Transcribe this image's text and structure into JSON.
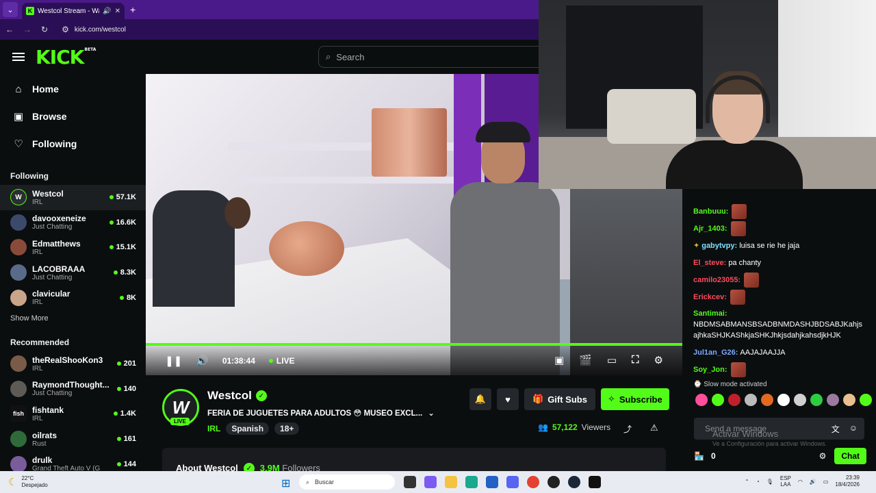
{
  "browser": {
    "tab_title": "Westcol Stream - Watch Li",
    "url": "kick.com/westcol"
  },
  "header": {
    "logo": "KICK",
    "logo_badge": "BETA",
    "search_placeholder": "Search"
  },
  "sidebar": {
    "nav": [
      {
        "label": "Home",
        "icon": "home-icon"
      },
      {
        "label": "Browse",
        "icon": "browse-icon"
      },
      {
        "label": "Following",
        "icon": "heart-icon"
      }
    ],
    "following_title": "Following",
    "following": [
      {
        "name": "Westcol",
        "category": "IRL",
        "viewers": "57.1K"
      },
      {
        "name": "davooxeneize",
        "category": "Just Chatting",
        "viewers": "16.6K"
      },
      {
        "name": "Edmatthews",
        "category": "IRL",
        "viewers": "15.1K"
      },
      {
        "name": "LACOBRAAA",
        "category": "Just Chatting",
        "viewers": "8.3K"
      },
      {
        "name": "clavicular",
        "category": "IRL",
        "viewers": "8K"
      }
    ],
    "show_more": "Show More",
    "recommended_title": "Recommended",
    "recommended": [
      {
        "name": "theRealShooKon3",
        "category": "IRL",
        "viewers": "201"
      },
      {
        "name": "RaymondThought...",
        "category": "Just Chatting",
        "viewers": "140"
      },
      {
        "name": "fishtank",
        "category": "IRL",
        "viewers": "1.4K"
      },
      {
        "name": "oilrats",
        "category": "Rust",
        "viewers": "161"
      },
      {
        "name": "drulk",
        "category": "Grand Theft Auto V (G",
        "viewers": "144"
      }
    ]
  },
  "player": {
    "time": "01:38:44",
    "live": "LIVE"
  },
  "channel": {
    "name": "Westcol",
    "avatar_letter": "W",
    "live_badge": "LIVE",
    "title": "FERIA DE JUGUETES PARA ADULTOS 😳 MUSEO EXCL...",
    "category": "IRL",
    "tags": [
      "Spanish",
      "18+"
    ],
    "gift_label": "Gift Subs",
    "subscribe_label": "Subscribe",
    "viewers": "57,122",
    "viewers_label": "Viewers",
    "about_title": "About Westcol",
    "followers": "3.9M",
    "followers_label": "Followers"
  },
  "chat": {
    "messages": [
      {
        "user": "Banbuuu:",
        "text": "",
        "color": "#53fc18",
        "emote": true
      },
      {
        "user": "Ajr_1403:",
        "text": "",
        "color": "#53fc18",
        "emote": true
      },
      {
        "user": "gabytvpy:",
        "text": "luisa se rie he jaja",
        "color": "#7ee0ff",
        "emote": false
      },
      {
        "user": "El_steve:",
        "text": "pa chanty",
        "color": "#ff4b5c",
        "emote": false
      },
      {
        "user": "camilo23055:",
        "text": "",
        "color": "#ff4b5c",
        "emote": true
      },
      {
        "user": "Erickcev:",
        "text": "",
        "color": "#ff4b5c",
        "emote": true
      },
      {
        "user": "Santimai:",
        "text": "NBDMSABMANSBSADBNMDASHJBDSABJKahjsajhkaSHJKAShkjaSHKJhkjsdahjkahsdjkHJK",
        "color": "#53fc18",
        "emote": false
      },
      {
        "user": "Jul1an_G26:",
        "text": "AAJAJAAJJA",
        "color": "#7ea8ff",
        "emote": false
      },
      {
        "user": "Soy_Jon:",
        "text": "",
        "color": "#53fc18",
        "emote": true
      }
    ],
    "slow_mode": "Slow mode activated",
    "input_placeholder": "Send a message",
    "points": "0",
    "chat_button": "Chat",
    "windows_activate": "Activar Windows",
    "windows_activate_sub": "Ve a Configuración para activar Windows."
  },
  "taskbar": {
    "temp": "22°C",
    "weather": "Despejado",
    "search": "Buscar",
    "lang": "ESP",
    "lang2": "LAA",
    "time": "23:39",
    "date": "18/4/2026"
  }
}
